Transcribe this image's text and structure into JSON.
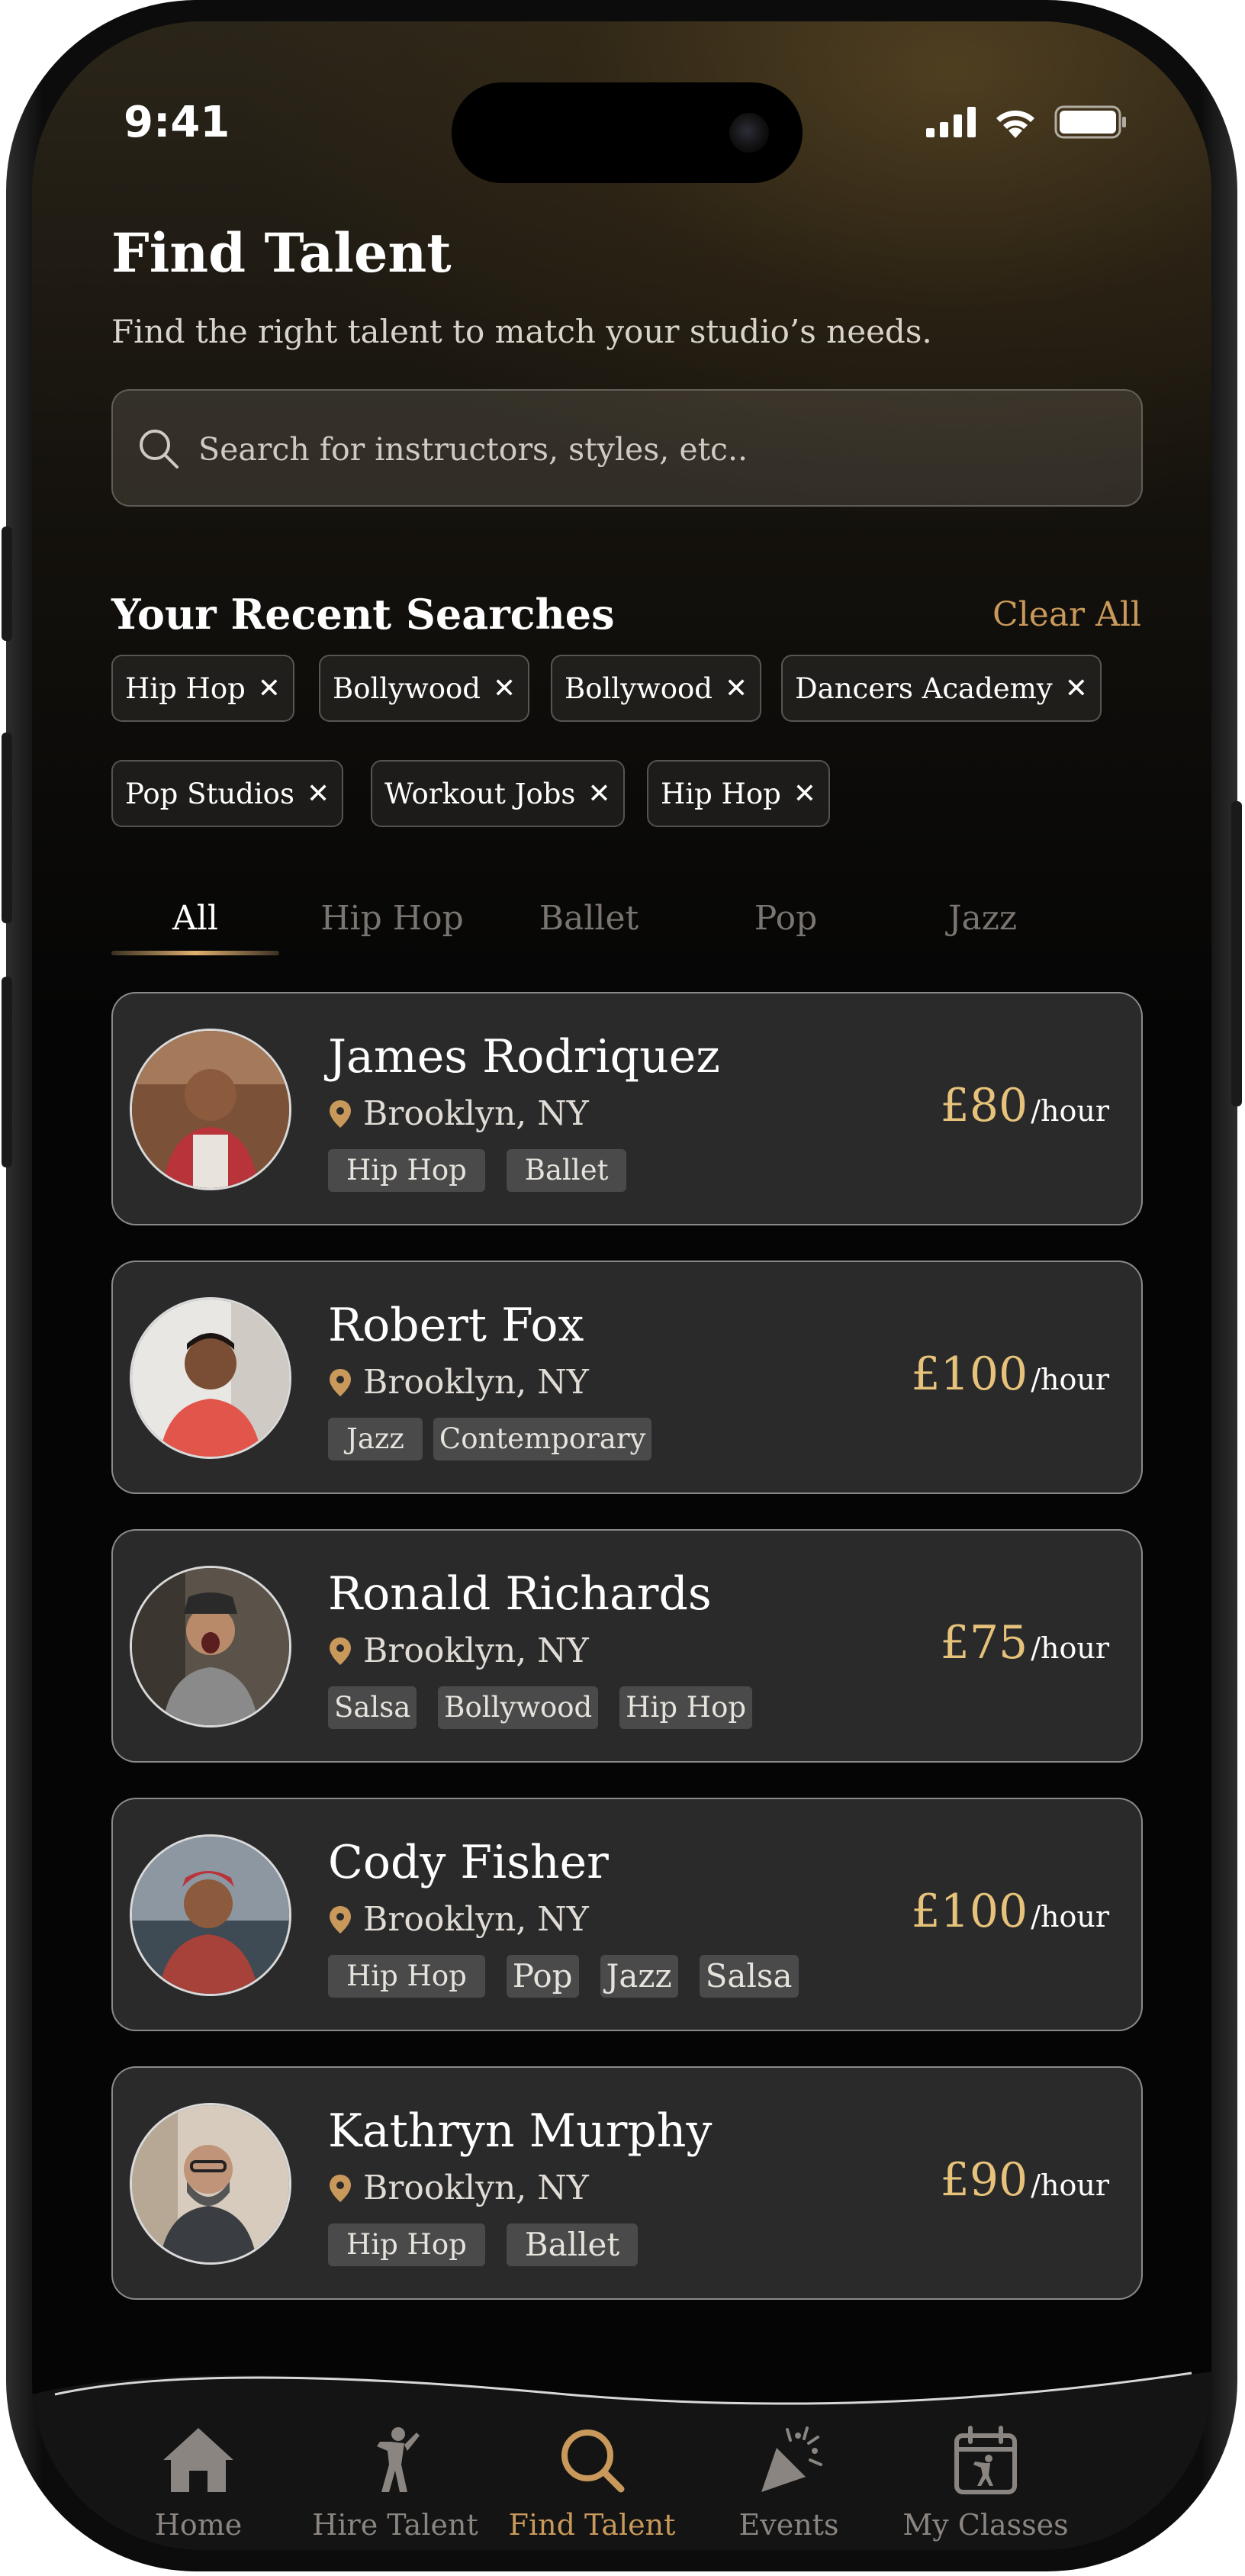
{
  "status_bar": {
    "time": "9:41"
  },
  "header": {
    "title": "Find Talent",
    "subtitle": "Find the right talent to match your studio’s needs."
  },
  "search": {
    "placeholder": "Search for instructors, styles, etc.."
  },
  "recent_searches": {
    "title": "Your Recent Searches",
    "clear_all": "Clear All",
    "chips": [
      "Hip Hop",
      "Bollywood",
      "Bollywood",
      "Dancers Academy",
      "Pop Studios",
      "Workout Jobs",
      "Hip Hop"
    ]
  },
  "filter_tabs": [
    "All",
    "Hip Hop",
    "Ballet",
    "Pop",
    "Jazz"
  ],
  "active_tab": "All",
  "talents": [
    {
      "name": "James Rodriquez",
      "location": "Brooklyn, NY",
      "tags": [
        "Hip Hop",
        "Ballet"
      ],
      "price": "£80",
      "unit": "/hour"
    },
    {
      "name": "Robert Fox",
      "location": "Brooklyn, NY",
      "tags": [
        "Jazz",
        "Contemporary"
      ],
      "price": "£100",
      "unit": "/hour"
    },
    {
      "name": "Ronald Richards",
      "location": "Brooklyn, NY",
      "tags": [
        "Salsa",
        "Bollywood",
        "Hip Hop"
      ],
      "price": "£75",
      "unit": "/hour"
    },
    {
      "name": "Cody Fisher",
      "location": "Brooklyn, NY",
      "tags": [
        "Hip Hop",
        "Pop",
        "Jazz",
        "Salsa"
      ],
      "price": "£100",
      "unit": "/hour"
    },
    {
      "name": "Kathryn Murphy",
      "location": "Brooklyn, NY",
      "tags": [
        "Hip Hop",
        "Ballet"
      ],
      "price": "£90",
      "unit": "/hour"
    }
  ],
  "bottom_nav": {
    "items": [
      {
        "label": "Home",
        "icon": "home-icon"
      },
      {
        "label": "Hire Talent",
        "icon": "dancer-icon"
      },
      {
        "label": "Find Talent",
        "icon": "search-icon"
      },
      {
        "label": "Events",
        "icon": "party-popper-icon"
      },
      {
        "label": "My Classes",
        "icon": "calendar-dancer-icon"
      }
    ],
    "active": "Find Talent"
  },
  "colors": {
    "accent": "#c8995a",
    "price": "#e6c27a",
    "card": "#2a2a2a",
    "tag": "#4a4a4a"
  }
}
